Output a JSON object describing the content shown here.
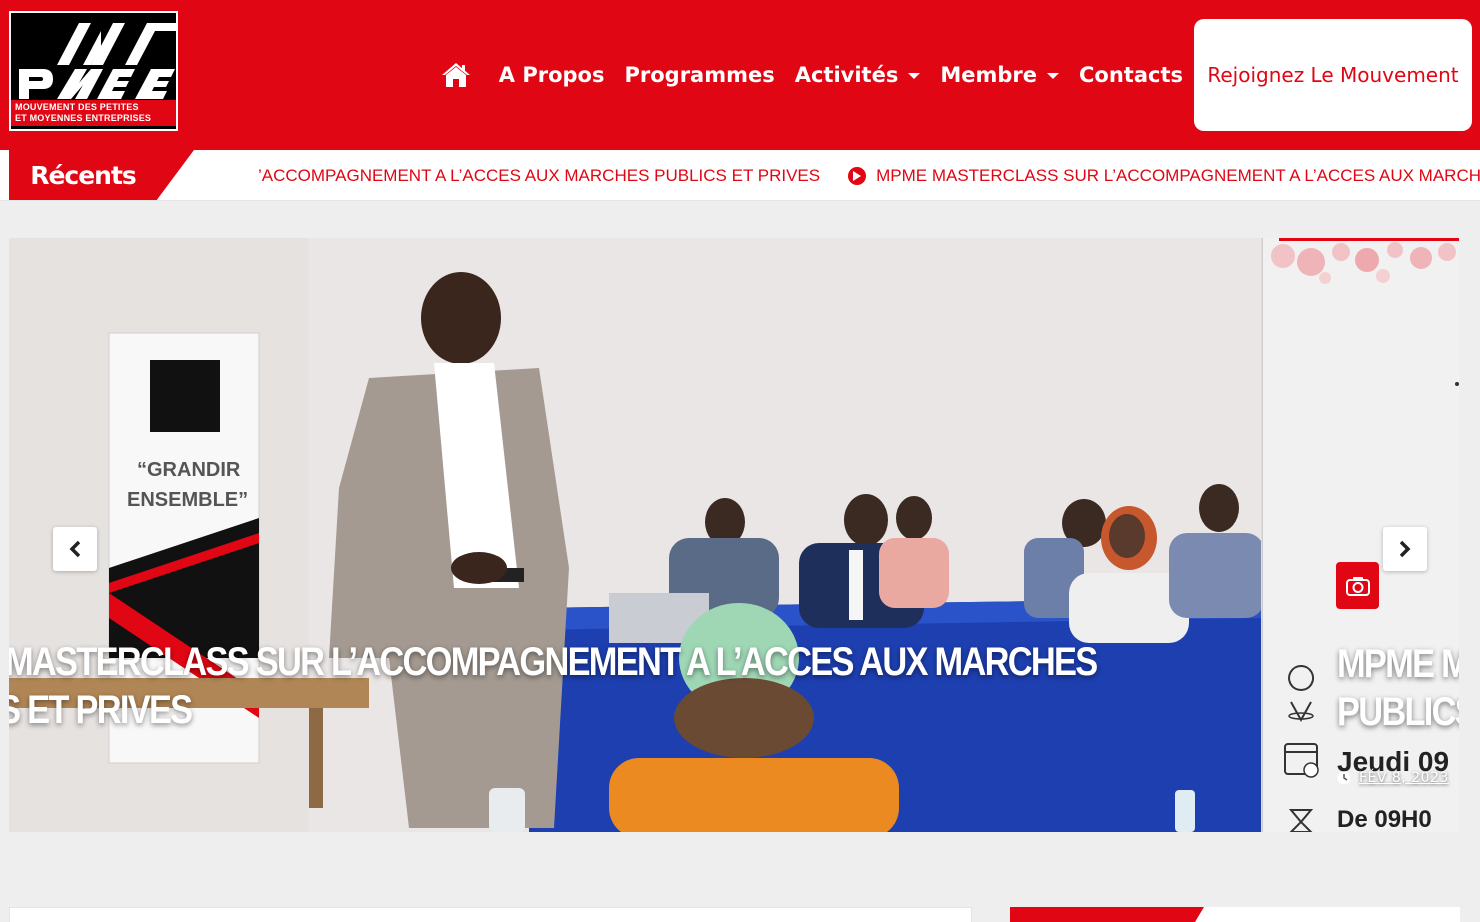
{
  "logo": {
    "tagline_line1": "MOUVEMENT DES PETITES",
    "tagline_line2": "ET MOYENNES ENTREPRISES"
  },
  "nav": {
    "home_icon": "home-icon",
    "items": [
      {
        "label": "A Propos",
        "dropdown": false
      },
      {
        "label": "Programmes",
        "dropdown": false
      },
      {
        "label": "Activités",
        "dropdown": true
      },
      {
        "label": "Membre",
        "dropdown": true
      },
      {
        "label": "Contacts",
        "dropdown": false
      }
    ],
    "cta_label": "Rejoignez Le Mouvement"
  },
  "ticker": {
    "label": "Récents",
    "items": [
      "MPME MASTERCLASS SUR L’ACCOMPAGNEMENT A L’ACCES AUX MARCHES PUBLICS ET PRIVES",
      "MPME MASTERCLASS SUR L’ACCOMPAGNEMENT A L’ACCES AUX MARCHES PUBLICS ET PRIVES"
    ],
    "first_visible": "’ACCOMPAGNEMENT A L’ACCES AUX MARCHES PUBLICS ET PRIVES"
  },
  "slider": {
    "main_title_line1": "MASTERCLASS SUR L’ACCOMPAGNEMENT A L’ACCES AUX MARCHES",
    "main_title_line2": "S ET PRIVES",
    "banner_text1": "“GRANDIR",
    "banner_text2": "ENSEMBLE”",
    "next_title_line1": "MPME M",
    "next_title_line2": "PUBLICS",
    "next_date": "FÉV 8, 2023",
    "next_poster_line1": "Jeudi 09",
    "next_poster_line2": "De 09H0"
  },
  "colors": {
    "brand_red": "#e10613",
    "white": "#ffffff",
    "page_bg": "#eeeeee"
  }
}
